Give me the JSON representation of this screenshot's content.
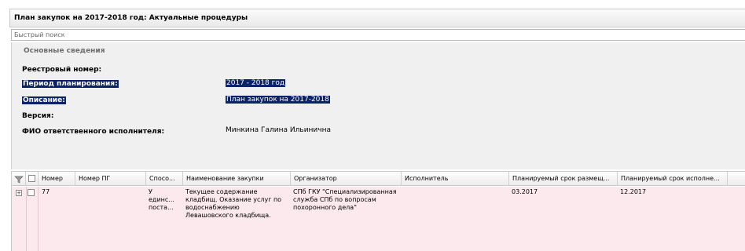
{
  "window": {
    "title": "План закупок на 2017-2018 год: Актуальные процедуры"
  },
  "search": {
    "placeholder": "Быстрый поиск",
    "value": ""
  },
  "info": {
    "section_title": "Основные сведения",
    "fields": [
      {
        "label": "Реестровый номер:",
        "value": ""
      },
      {
        "label": "Период планирования:",
        "value": "2017 - 2018 год"
      },
      {
        "label": "Описание:",
        "value": "План закупок на 2017-2018"
      },
      {
        "label": "Версия:",
        "value": ""
      },
      {
        "label": "ФИО ответственного исполнителя:",
        "value": "Минкина Галина Ильинична"
      }
    ]
  },
  "grid": {
    "filter_icon": "filter-icon",
    "columns": [
      "Номер",
      "Номер ПГ",
      "Спосо...",
      "Наименование закупки",
      "Организатор",
      "Исполнитель",
      "Планируемый срок размещ...",
      "Планируемый срок исполне..."
    ],
    "rows": [
      {
        "number": "77",
        "pg_number": "",
        "method": "У единс... поста...",
        "name": "Текущее содержание кладбищ. Оказание услуг по водоснабжению Левашовского кладбища.",
        "organizer": "СПб ГКУ \"Специализированная служба СПб по вопросам похоронного дела\"",
        "executor": "",
        "placement_date": "03.2017",
        "execution_date": "12.2017"
      }
    ]
  },
  "colors": {
    "selection": "#0b2469",
    "row_background": "#fbe9ee",
    "panel_background": "#f0f0f0"
  }
}
